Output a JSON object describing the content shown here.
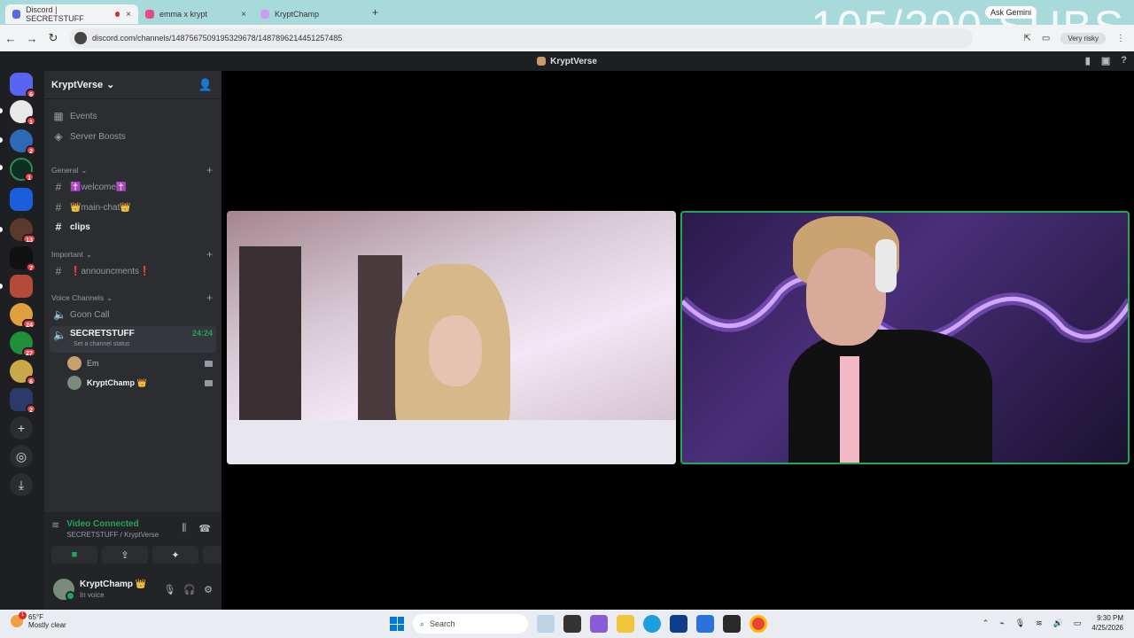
{
  "browser": {
    "tabs": [
      {
        "label": "Discord | SECRETSTUFF",
        "active": true
      },
      {
        "label": "emma x krypt",
        "active": false
      },
      {
        "label": "KryptChamp",
        "active": false
      }
    ],
    "new_tab": "+",
    "close": "×",
    "url": "discord.com/channels/1487567509195329678/1487896214451257485",
    "ask_gemini": "Ask Gemini",
    "profile_label": "Very risky",
    "overlay": "105/200 SUBS"
  },
  "discord": {
    "window_title": "KryptVerse",
    "server_name": "KryptVerse",
    "menu": [
      {
        "label": "Events",
        "icon": "calendar-icon"
      },
      {
        "label": "Server Boosts",
        "icon": "boost-icon"
      }
    ],
    "categories": {
      "general": "General",
      "important": "Important",
      "voice": "Voice Channels"
    },
    "text_channels": [
      {
        "label": "✝️welcome✝️"
      },
      {
        "label": "👑main-chat👑"
      },
      {
        "label": "clips"
      }
    ],
    "important_channels": [
      {
        "label": "❗announcments❗"
      }
    ],
    "voice_channels": [
      {
        "label": "Goon Call"
      },
      {
        "label": "SECRETSTUFF",
        "time": "24:24",
        "status": "Set a channel status"
      }
    ],
    "members": [
      {
        "name": "Em"
      },
      {
        "name": "KryptChamp 👑"
      }
    ],
    "voice_panel": {
      "status": "Video Connected",
      "channel": "SECRETSTUFF / KryptVerse"
    },
    "user": {
      "name": "KryptChamp 👑",
      "status": "In voice"
    },
    "server_badges": [
      "6",
      "1",
      "2",
      "1",
      "13",
      "7",
      "24",
      "27",
      "6",
      "2"
    ]
  },
  "taskbar": {
    "temp": "65°F",
    "weather": "Mostly clear",
    "weather_badge": "1",
    "search": "Search",
    "time": "9:30 PM",
    "date": "4/25/2026"
  },
  "colors": {
    "accent_green": "#23a55a",
    "blurple": "#5865f2",
    "badge_red": "#f23f43"
  }
}
